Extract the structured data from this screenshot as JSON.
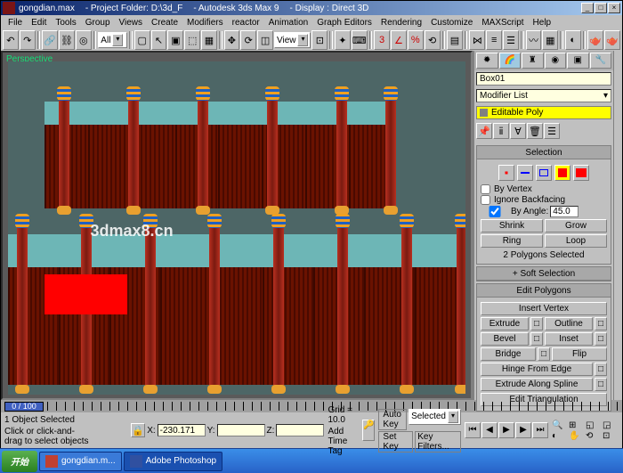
{
  "title": {
    "file": "gongdian.max",
    "project": "- Project Folder: D:\\3d_F",
    "app": "- Autodesk 3ds Max 9",
    "display": "- Display : Direct 3D"
  },
  "win_buttons": {
    "min": "_",
    "max": "□",
    "close": "×"
  },
  "menus": [
    "File",
    "Edit",
    "Tools",
    "Group",
    "Views",
    "Create",
    "Modifiers",
    "reactor",
    "Animation",
    "Graph Editors",
    "Rendering",
    "Customize",
    "MAXScript",
    "Help"
  ],
  "toolbar": {
    "combo_all": "All",
    "combo_view": "View"
  },
  "viewport": {
    "label": "Perspective",
    "watermark": "3dmax8.cn"
  },
  "modify": {
    "object_name": "Box01",
    "modlist": "Modifier List",
    "stack_item": "Editable Poly"
  },
  "selection": {
    "title": "Selection",
    "by_vertex": "By Vertex",
    "ignore_bf": "Ignore Backfacing",
    "by_angle": "By Angle:",
    "angle_val": "45.0",
    "shrink": "Shrink",
    "grow": "Grow",
    "ring": "Ring",
    "loop": "Loop",
    "status": "2 Polygons Selected"
  },
  "rollouts": {
    "soft": "Soft Selection",
    "editpoly": "Edit Polygons",
    "insert_v": "Insert Vertex",
    "extrude": "Extrude",
    "outline": "Outline",
    "bevel": "Bevel",
    "inset": "Inset",
    "bridge": "Bridge",
    "flip": "Flip",
    "hinge": "Hinge From Edge",
    "extrude_spline": "Extrude Along Spline",
    "edit_tri": "Edit Triangulation"
  },
  "timeline": {
    "frame": "0 / 100"
  },
  "status": {
    "sel": "1 Object Selected",
    "x": "-230.171",
    "y": "",
    "z": "",
    "grid": "Grid = 10.0",
    "autokey": "Auto Key",
    "setkey": "Set Key",
    "selected": "Selected",
    "keyfilters": "Key Filters...",
    "hint": "Click or click-and-drag to select objects",
    "timetag": "Add Time Tag"
  },
  "taskbar": {
    "start": "开始",
    "t1": "gongdian.m...",
    "t2": "Adobe Photoshop"
  }
}
